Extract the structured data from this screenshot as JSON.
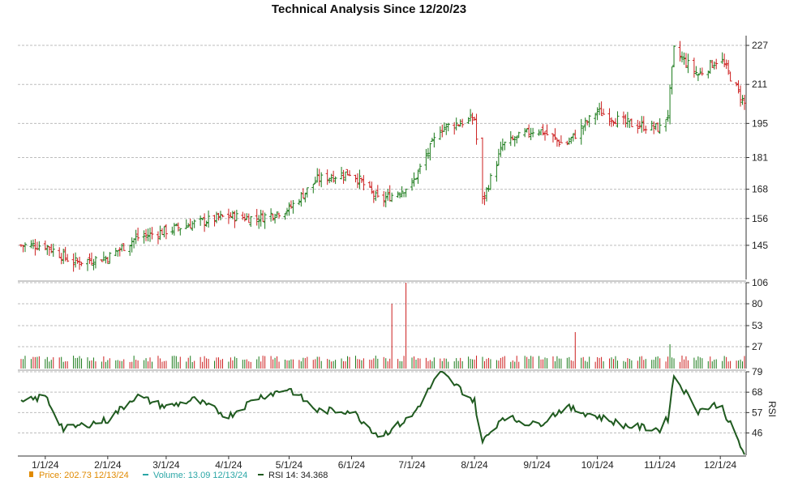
{
  "chart_data": {
    "type": "candlestick-with-volume-and-rsi",
    "title": "Technical Analysis Since 12/20/23",
    "colors": {
      "up": "#1a7a1a",
      "down": "#cc1f1f",
      "rsi": "#1f5a1f",
      "price_legend": "#e08a00",
      "volume_legend": "#2aa6a6"
    },
    "x_tick_labels": [
      "1/1/24",
      "2/1/24",
      "3/1/24",
      "4/1/24",
      "5/1/24",
      "6/1/24",
      "7/1/24",
      "8/1/24",
      "9/1/24",
      "10/1/24",
      "11/1/24",
      "12/1/24"
    ],
    "price_panel": {
      "y_ticks": [
        145,
        156,
        168,
        181,
        195,
        211,
        227
      ],
      "ylim": [
        131,
        231
      ],
      "grid": true,
      "closes_monthly_anchor": [
        [
          "12/20/23",
          145
        ],
        [
          "1/1/24",
          145
        ],
        [
          "1/15/24",
          138
        ],
        [
          "2/1/24",
          140
        ],
        [
          "2/15/24",
          148
        ],
        [
          "3/1/24",
          151
        ],
        [
          "3/15/24",
          154
        ],
        [
          "4/1/24",
          157
        ],
        [
          "4/15/24",
          156
        ],
        [
          "5/1/24",
          160
        ],
        [
          "5/15/24",
          172
        ],
        [
          "6/1/24",
          175
        ],
        [
          "6/15/24",
          163
        ],
        [
          "7/1/24",
          170
        ],
        [
          "7/15/24",
          193
        ],
        [
          "8/1/24",
          197
        ],
        [
          "8/5/24",
          163
        ],
        [
          "8/15/24",
          186
        ],
        [
          "9/1/24",
          193
        ],
        [
          "9/15/24",
          186
        ],
        [
          "10/1/24",
          200
        ],
        [
          "10/15/24",
          195
        ],
        [
          "11/1/24",
          193
        ],
        [
          "11/5/24",
          199
        ],
        [
          "11/8/24",
          225
        ],
        [
          "11/20/24",
          215
        ],
        [
          "12/1/24",
          222
        ],
        [
          "12/13/24",
          203
        ]
      ]
    },
    "volume_panel": {
      "y_ticks": [
        27,
        53,
        80,
        106
      ],
      "ylim": [
        0,
        106
      ],
      "grid": true,
      "spikes": [
        [
          "6/21/24",
          80
        ],
        [
          "6/28/24",
          106
        ],
        [
          "9/20/24",
          45
        ],
        [
          "11/6/24",
          30
        ]
      ]
    },
    "rsi_panel": {
      "ylabel": "RSI",
      "y_ticks": [
        46,
        57,
        68,
        79
      ],
      "ylim": [
        34,
        79
      ],
      "grid": true,
      "anchors": [
        [
          "12/20/23",
          62
        ],
        [
          "1/1/24",
          66
        ],
        [
          "1/10/24",
          48
        ],
        [
          "2/1/24",
          53
        ],
        [
          "2/15/24",
          66
        ],
        [
          "3/1/24",
          60
        ],
        [
          "3/15/24",
          64
        ],
        [
          "4/1/24",
          55
        ],
        [
          "4/15/24",
          65
        ],
        [
          "5/1/24",
          70
        ],
        [
          "5/15/24",
          58
        ],
        [
          "6/1/24",
          58
        ],
        [
          "6/15/24",
          44
        ],
        [
          "7/1/24",
          55
        ],
        [
          "7/15/24",
          79
        ],
        [
          "8/1/24",
          63
        ],
        [
          "8/5/24",
          41
        ],
        [
          "8/15/24",
          55
        ],
        [
          "9/1/24",
          50
        ],
        [
          "9/15/24",
          60
        ],
        [
          "10/1/24",
          55
        ],
        [
          "10/15/24",
          50
        ],
        [
          "11/1/24",
          48
        ],
        [
          "11/5/24",
          54
        ],
        [
          "11/8/24",
          77
        ],
        [
          "11/20/24",
          58
        ],
        [
          "12/1/24",
          62
        ],
        [
          "12/13/24",
          34.368
        ]
      ]
    }
  },
  "legend": {
    "price": "Price: 202.73  12/13/24",
    "volume": "Volume: 13.09  12/13/24",
    "rsi": "RSI 14: 34.368"
  }
}
